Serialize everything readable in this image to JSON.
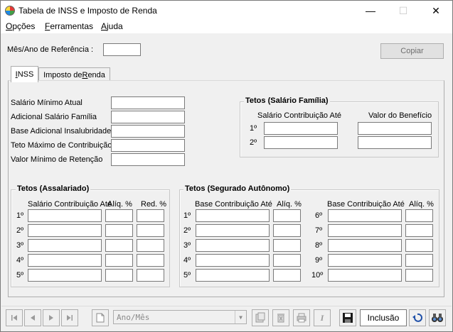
{
  "window": {
    "title": "Tabela de INSS e Imposto de Renda",
    "minimize": "—",
    "maximize": "☐",
    "close": "✕"
  },
  "menu": [
    {
      "accel": "O",
      "rest": "pções"
    },
    {
      "accel": "F",
      "rest": "erramentas"
    },
    {
      "accel": "A",
      "rest": "juda"
    }
  ],
  "header": {
    "ref_label": "Mês/Ano de Referência :",
    "ref_value": "",
    "copy_label": "Copiar"
  },
  "tabs": [
    {
      "accel": "I",
      "rest": "NSS"
    },
    {
      "pre": "Imposto de ",
      "accel": "R",
      "rest": "enda"
    }
  ],
  "inss": {
    "fields": [
      "Salário Mínimo Atual",
      "Adicional Salário Família",
      "Base Adicional Insalubridade",
      "Teto Máximo de Contribuição",
      "Valor Mínimo de Retenção"
    ],
    "familia": {
      "title": "Tetos (Salário Família)",
      "col1": "Salário Contribuição Até",
      "col2": "Valor do Benefício",
      "rows": [
        "1º",
        "2º"
      ]
    },
    "assalariado": {
      "title": "Tetos (Assalariado)",
      "col1": "Salário Contribuição Até",
      "col2": "Alíq. %",
      "col3": "Red. %",
      "rows": [
        "1º",
        "2º",
        "3º",
        "4º",
        "5º"
      ]
    },
    "autonomo": {
      "title": "Tetos (Segurado Autônomo)",
      "col1": "Base Contribuição Até",
      "col2": "Alíq. %",
      "rows_left": [
        "1º",
        "2º",
        "3º",
        "4º",
        "5º"
      ],
      "rows_right": [
        "6º",
        "7º",
        "8º",
        "9º",
        "10º"
      ]
    }
  },
  "toolbar": {
    "combo_value": "Ano/Mês",
    "status": "Inclusão",
    "icons": [
      "first-icon",
      "previous-icon",
      "next-icon",
      "last-icon",
      "new-document-icon",
      "import-icon",
      "delete-icon",
      "print-icon",
      "italic-icon",
      "save-icon",
      "undo-icon",
      "binoculars-icon"
    ]
  }
}
